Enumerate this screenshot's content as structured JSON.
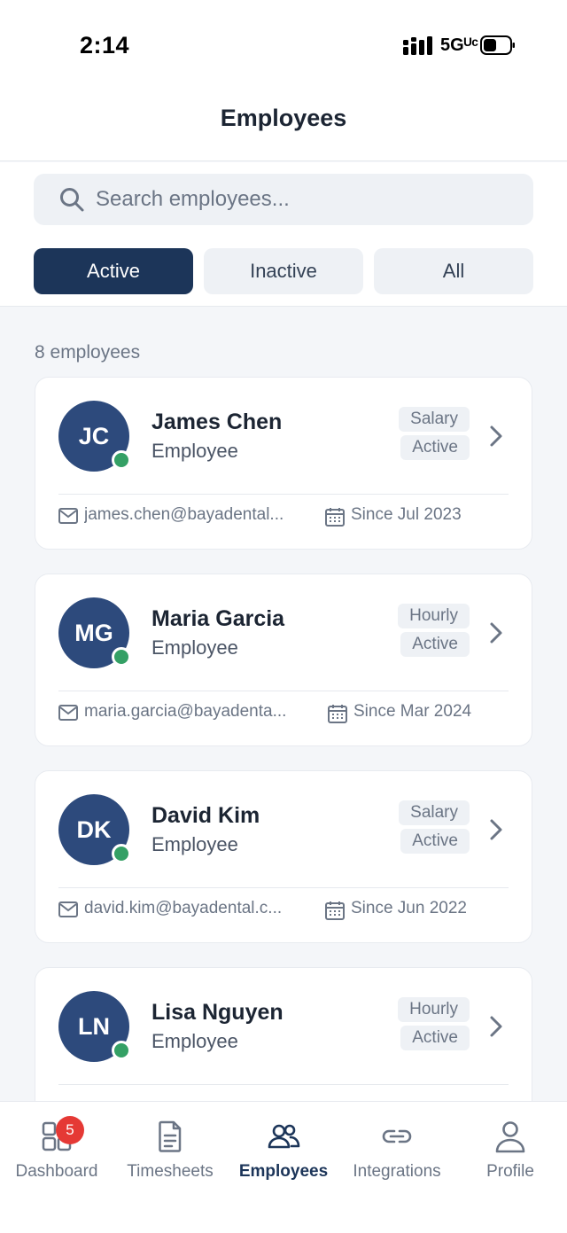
{
  "status_bar": {
    "time": "2:14",
    "network": "5Gᵁᶜ"
  },
  "header": {
    "title": "Employees"
  },
  "search": {
    "placeholder": "Search employees..."
  },
  "filters": [
    {
      "label": "Active",
      "selected": true
    },
    {
      "label": "Inactive",
      "selected": false
    },
    {
      "label": "All",
      "selected": false
    }
  ],
  "count_label": "8 employees",
  "employees": [
    {
      "initials": "JC",
      "name": "James Chen",
      "role": "Employee",
      "pay_type": "Salary",
      "status": "Active",
      "email": "james.chen@bayadental...",
      "since": "Since Jul 2023"
    },
    {
      "initials": "MG",
      "name": "Maria Garcia",
      "role": "Employee",
      "pay_type": "Hourly",
      "status": "Active",
      "email": "maria.garcia@bayadenta...",
      "since": "Since Mar 2024"
    },
    {
      "initials": "DK",
      "name": "David Kim",
      "role": "Employee",
      "pay_type": "Salary",
      "status": "Active",
      "email": "david.kim@bayadental.c...",
      "since": "Since Jun 2022"
    },
    {
      "initials": "LN",
      "name": "Lisa Nguyen",
      "role": "Employee",
      "pay_type": "Hourly",
      "status": "Active",
      "email": "",
      "since": ""
    }
  ],
  "tabs": [
    {
      "label": "Dashboard",
      "icon": "grid-icon",
      "badge": "5"
    },
    {
      "label": "Timesheets",
      "icon": "document-icon"
    },
    {
      "label": "Employees",
      "icon": "people-icon",
      "current": true
    },
    {
      "label": "Integrations",
      "icon": "link-icon"
    },
    {
      "label": "Profile",
      "icon": "person-icon"
    }
  ],
  "colors": {
    "primary": "#1c3559",
    "avatar": "#2d4a7c",
    "online": "#34a065",
    "badge_red": "#e53935"
  }
}
